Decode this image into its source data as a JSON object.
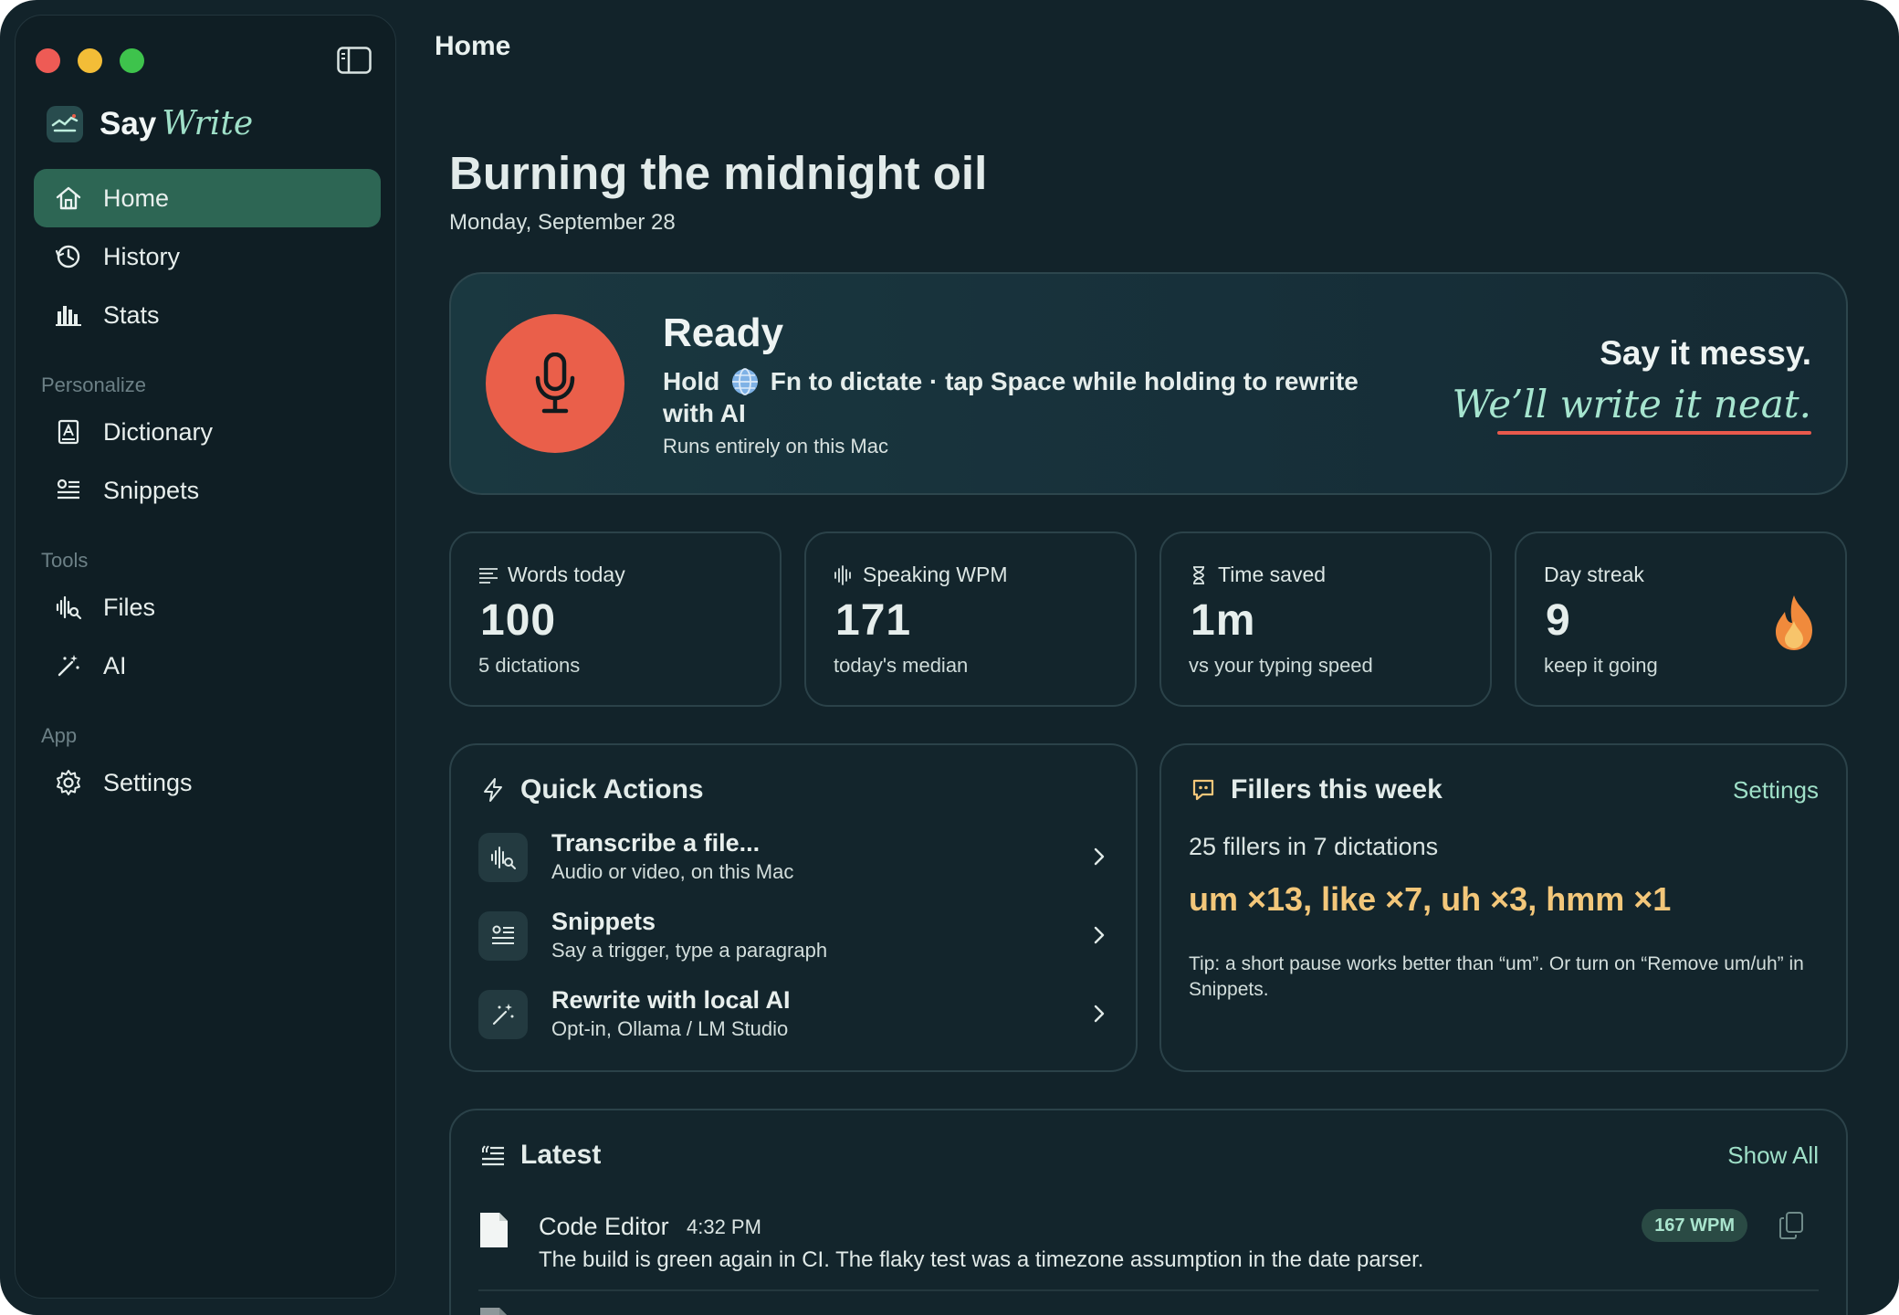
{
  "window": {
    "title": "Home"
  },
  "brand": {
    "say": "Say",
    "write": "Write"
  },
  "sidebar": {
    "items": [
      {
        "label": "Home",
        "icon": "home-icon",
        "active": true
      },
      {
        "label": "History",
        "icon": "history-icon"
      },
      {
        "label": "Stats",
        "icon": "stats-icon"
      }
    ],
    "sections": [
      {
        "title": "Personalize",
        "items": [
          {
            "label": "Dictionary",
            "icon": "dictionary-icon"
          },
          {
            "label": "Snippets",
            "icon": "snippets-icon"
          }
        ]
      },
      {
        "title": "Tools",
        "items": [
          {
            "label": "Files",
            "icon": "files-icon"
          },
          {
            "label": "AI",
            "icon": "ai-wand-icon"
          }
        ]
      },
      {
        "title": "App",
        "items": [
          {
            "label": "Settings",
            "icon": "gear-icon"
          }
        ]
      }
    ]
  },
  "main": {
    "greeting": "Burning the midnight oil",
    "date": "Monday, September 28",
    "hero": {
      "title": "Ready",
      "hold": "Hold",
      "instruction": "Fn to dictate · tap Space while holding to rewrite with AI",
      "note": "Runs entirely on this Mac",
      "tagline1": "Say it messy.",
      "tagline2": "We’ll write it neat."
    },
    "stats": [
      {
        "label": "Words today",
        "value": "100",
        "sub": "5 dictations",
        "icon": "text-lines-icon"
      },
      {
        "label": "Speaking WPM",
        "value": "171",
        "sub": "today's median",
        "icon": "waveform-icon"
      },
      {
        "label": "Time saved",
        "value": "1m",
        "sub": "vs your typing speed",
        "icon": "hourglass-icon"
      },
      {
        "label": "Day streak",
        "value": "9",
        "sub": "keep it going",
        "icon": "flame-icon"
      }
    ],
    "quick_actions": {
      "title": "Quick Actions",
      "items": [
        {
          "title": "Transcribe a file...",
          "desc": "Audio or video, on this Mac",
          "icon": "waveform-search-icon"
        },
        {
          "title": "Snippets",
          "desc": "Say a trigger, type a paragraph",
          "icon": "snippets-icon"
        },
        {
          "title": "Rewrite with local AI",
          "desc": "Opt-in, Ollama / LM Studio",
          "icon": "ai-wand-icon"
        }
      ]
    },
    "fillers": {
      "title": "Fillers this week",
      "settings_label": "Settings",
      "count": "25 fillers in 7 dictations",
      "words": "um ×13, like ×7, uh ×3, hmm ×1",
      "tip": "Tip: a short pause works better than “um”. Or turn on “Remove um/uh” in Snippets."
    },
    "latest": {
      "title": "Latest",
      "show_all": "Show All",
      "items": [
        {
          "app": "Code Editor",
          "time": "4:32 PM",
          "text": "The build is green again in CI. The flaky test was a timezone assumption in the date parser.",
          "wpm": "167 WPM"
        }
      ]
    }
  },
  "colors": {
    "accent": "#9fe0c8",
    "mic": "#ea5f4a",
    "active_nav": "#2d6654",
    "filler": "#f3c77a"
  }
}
